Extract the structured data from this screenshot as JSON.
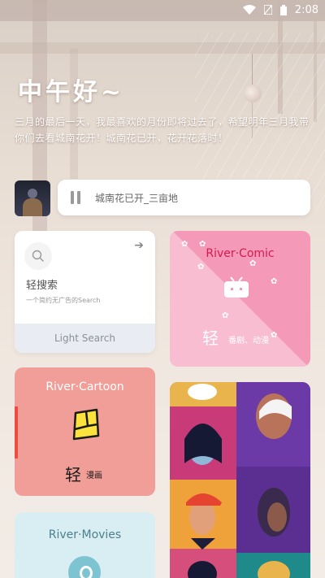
{
  "status_bar": {
    "time": "2:08"
  },
  "greeting": "中午好~",
  "quote": "三月的最后一天，我最喜欢的月份即将过去了，希望明年三月我带你们去看城南花开！城南花已开，花开花落时！",
  "player": {
    "song": "城南花已开_三亩地"
  },
  "search_card": {
    "title": "轻搜索",
    "subtitle": "一个简约无广告的Search",
    "footer": "Light Search"
  },
  "comic_card": {
    "title": "River·Comic",
    "big": "轻",
    "small": "番剧、动漫",
    "bg_color": "#f49ab8",
    "title_color": "#d6194f"
  },
  "cartoon_card": {
    "title": "River·Cartoon",
    "big": "轻",
    "small": "漫画",
    "bg_color": "#f19e98",
    "accent_color": "#ee4c3f"
  },
  "movies_card": {
    "title": "River·Movies",
    "bg_color": "#d9eef3"
  },
  "icons": [
    "wifi-icon",
    "sim-icon",
    "battery-icon",
    "pause-icon",
    "search-icon",
    "arrow-right-icon",
    "tv-icon",
    "comic-book-icon",
    "movie-play-icon"
  ]
}
